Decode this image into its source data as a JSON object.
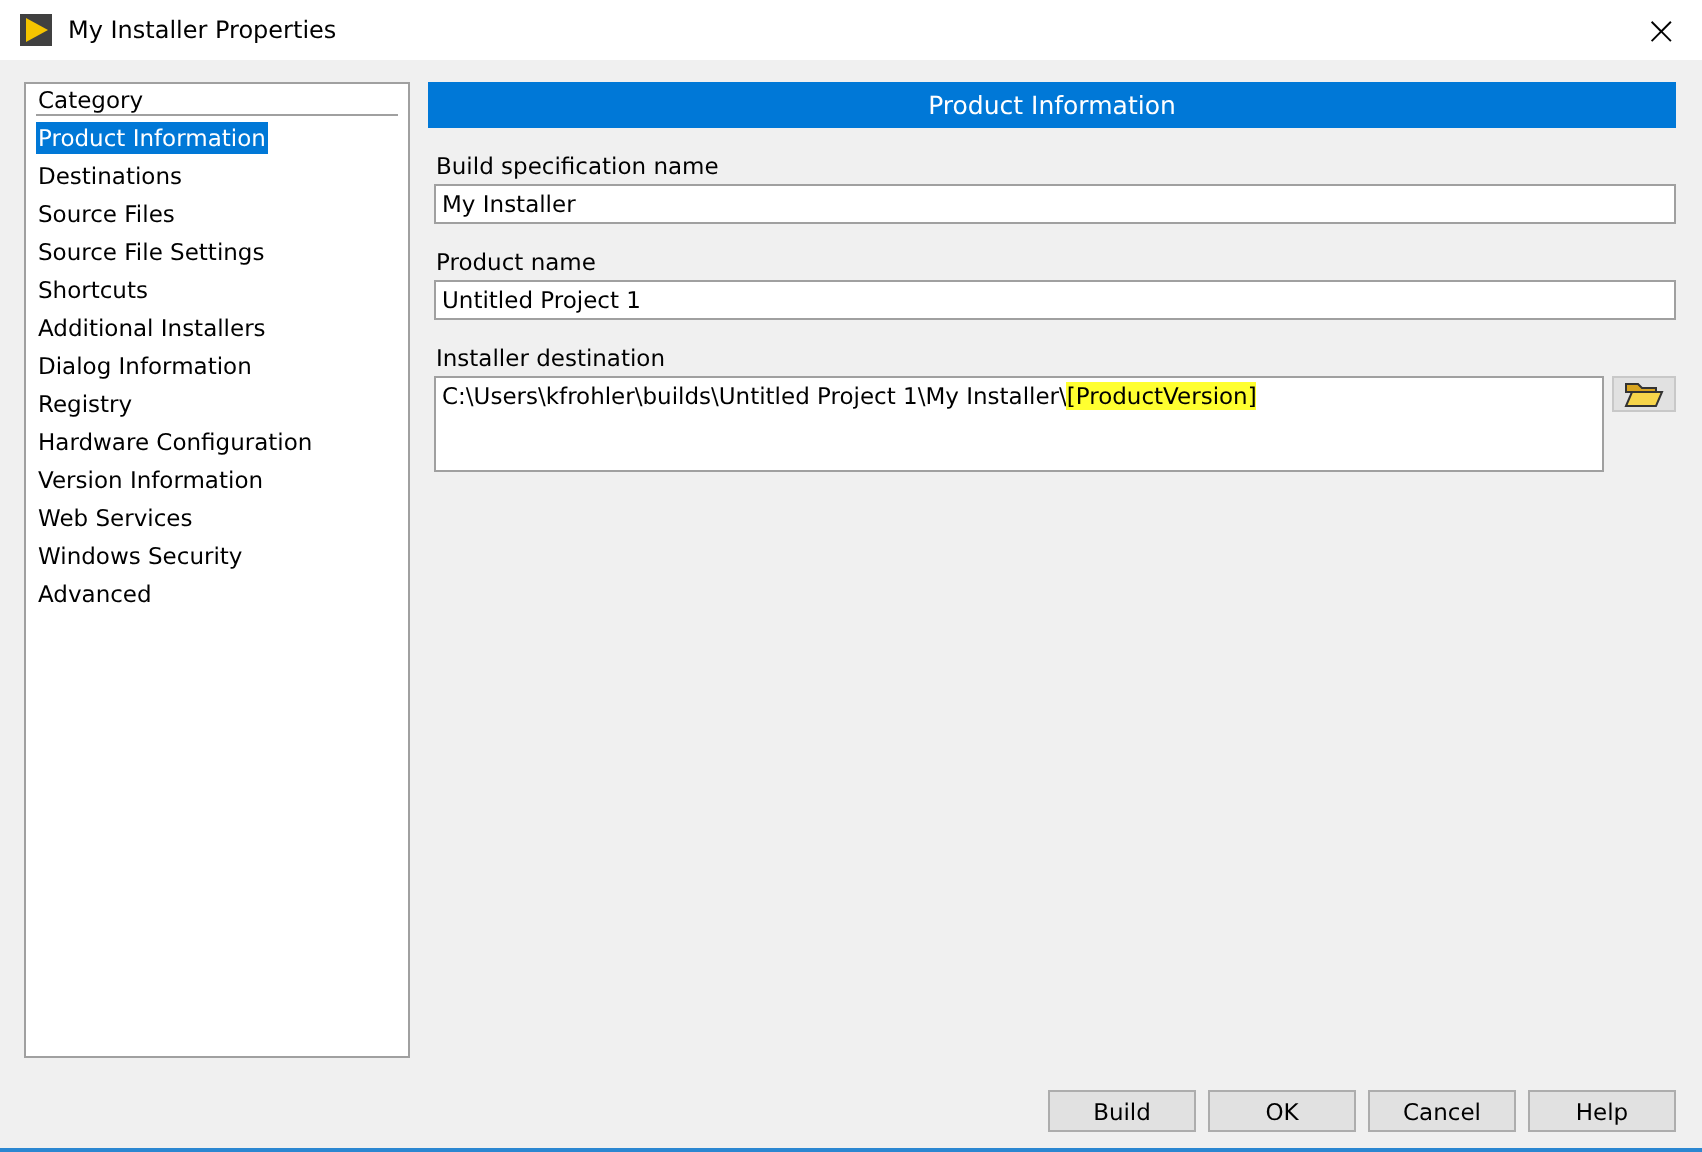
{
  "window": {
    "title": "My Installer Properties",
    "close": "×"
  },
  "sidebar": {
    "header": "Category",
    "items": [
      {
        "label": "Product Information",
        "selected": true
      },
      {
        "label": "Destinations",
        "selected": false
      },
      {
        "label": "Source Files",
        "selected": false
      },
      {
        "label": "Source File Settings",
        "selected": false
      },
      {
        "label": "Shortcuts",
        "selected": false
      },
      {
        "label": "Additional Installers",
        "selected": false
      },
      {
        "label": "Dialog Information",
        "selected": false
      },
      {
        "label": "Registry",
        "selected": false
      },
      {
        "label": "Hardware Configuration",
        "selected": false
      },
      {
        "label": "Version Information",
        "selected": false
      },
      {
        "label": "Web Services",
        "selected": false
      },
      {
        "label": "Windows Security",
        "selected": false
      },
      {
        "label": "Advanced",
        "selected": false
      }
    ]
  },
  "panel": {
    "title": "Product Information",
    "fields": [
      {
        "label": "Build specification name",
        "value": "My Installer"
      },
      {
        "label": "Product name",
        "value": "Untitled Project 1"
      }
    ],
    "destination": {
      "label": "Installer destination",
      "value": "C:\\Users\\kfrohler\\builds\\Untitled Project 1\\My Installer\\",
      "highlight": "[ProductVersion]"
    }
  },
  "buttons": [
    "Build",
    "OK",
    "Cancel",
    "Help"
  ]
}
